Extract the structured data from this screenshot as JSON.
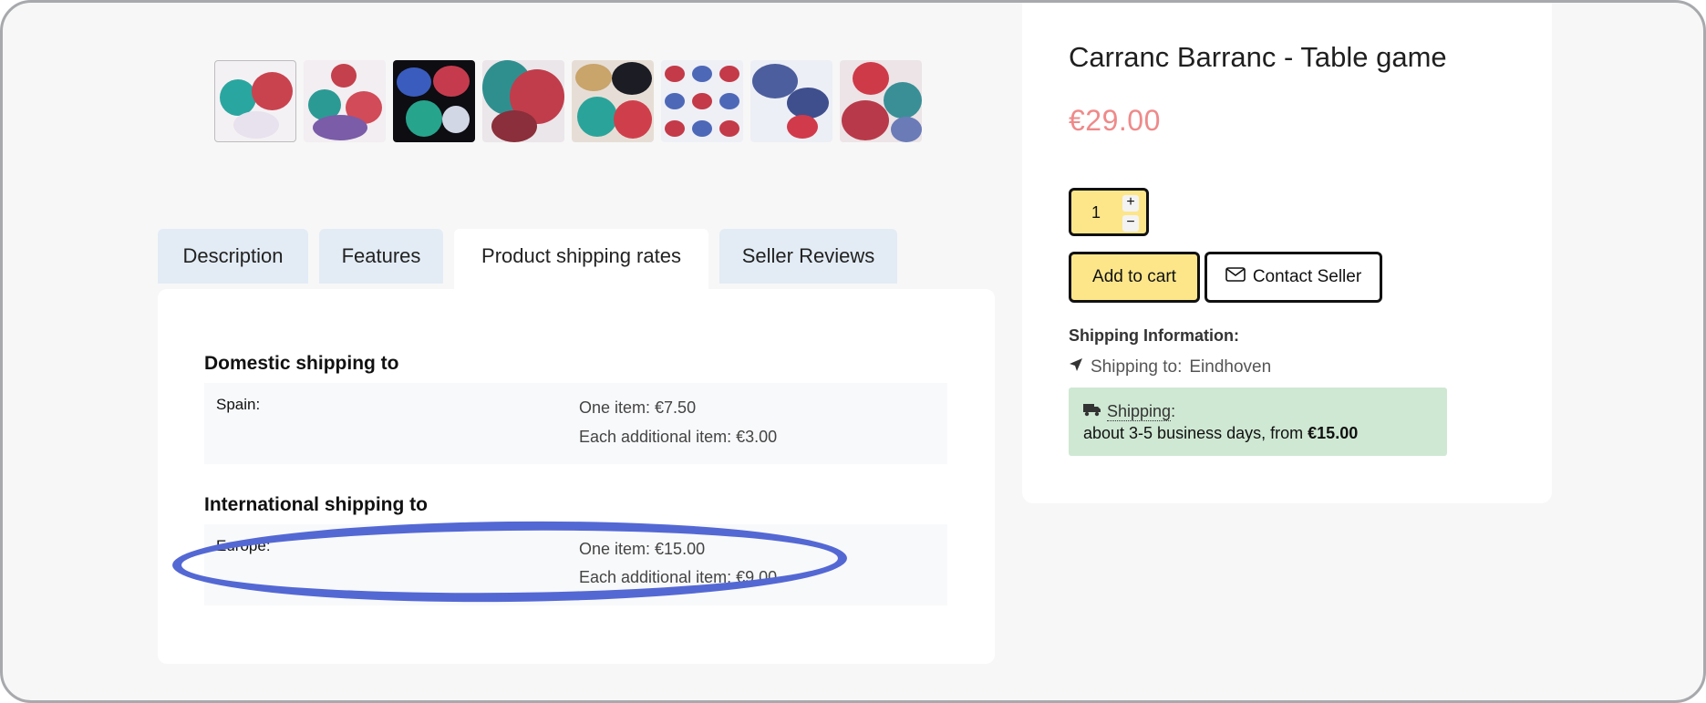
{
  "thumbnails": [
    {
      "alt": "thumbnail-1"
    },
    {
      "alt": "thumbnail-2"
    },
    {
      "alt": "thumbnail-3"
    },
    {
      "alt": "thumbnail-4"
    },
    {
      "alt": "thumbnail-5"
    },
    {
      "alt": "thumbnail-6"
    },
    {
      "alt": "thumbnail-7"
    },
    {
      "alt": "thumbnail-8"
    }
  ],
  "tabs": [
    {
      "label": "Description"
    },
    {
      "label": "Features"
    },
    {
      "label": "Product shipping rates"
    },
    {
      "label": "Seller Reviews"
    }
  ],
  "shipping_rates": {
    "domestic": {
      "title": "Domestic shipping to",
      "region": "Spain:",
      "one_item": "One item: €7.50",
      "each_additional": "Each additional item: €3.00"
    },
    "international": {
      "title": "International shipping to",
      "region": "Europe:",
      "one_item": "One item: €15.00",
      "each_additional": "Each additional item: €9.00"
    }
  },
  "product": {
    "title": "Carranc Barranc - Table game",
    "price": "€29.00",
    "quantity": "1",
    "plus": "+",
    "minus": "−",
    "add_to_cart": "Add to cart",
    "contact_seller": "Contact Seller"
  },
  "shipping_info": {
    "heading": "Shipping Information:",
    "shipping_to_label": "Shipping to:",
    "shipping_to_city": "Eindhoven",
    "link": "Shipping",
    "colon": ":",
    "estimate": "about 3-5 business days, from",
    "from_price": "€15.00"
  },
  "colors": {
    "accent_yellow": "#fde68a",
    "price": "#ef8a8a",
    "tab_inactive": "#e3ecf5",
    "shipping_box": "#cfe8d3",
    "annotation": "#5468d4"
  },
  "icons": {
    "location": "location-arrow-icon",
    "truck": "truck-icon",
    "envelope": "envelope-icon"
  }
}
